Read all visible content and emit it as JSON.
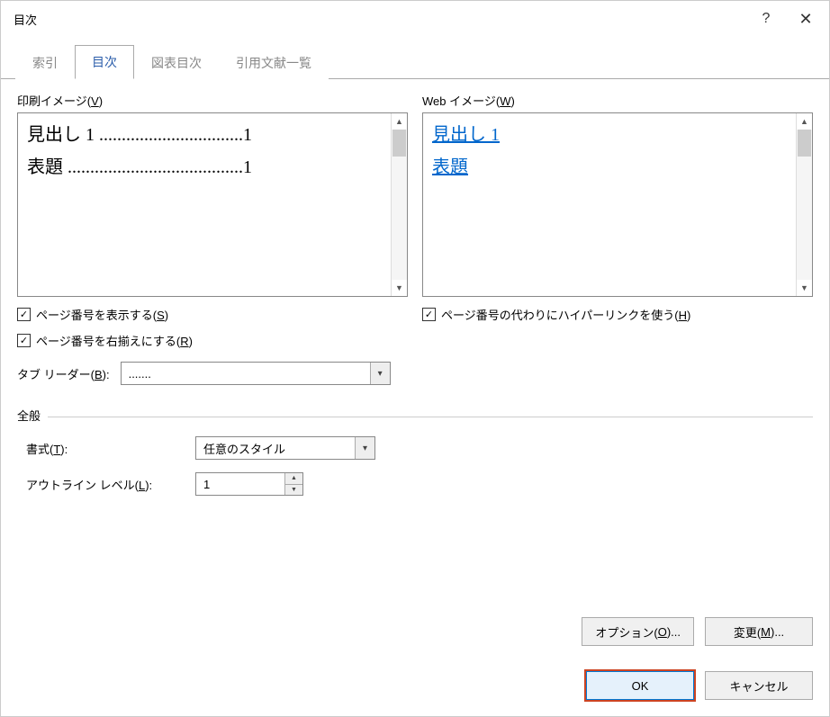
{
  "title": "目次",
  "help_icon": "?",
  "close_icon": "✕",
  "tabs": {
    "index": "索引",
    "toc": "目次",
    "figures": "図表目次",
    "citations": "引用文献一覧"
  },
  "print_preview": {
    "label_pre": "印刷イメージ(",
    "label_key": "V",
    "label_post": ")",
    "line1": "見出し 1 ................................1",
    "line2": "表題 .......................................1"
  },
  "web_preview": {
    "label_pre": "Web イメージ(",
    "label_key": "W",
    "label_post": ")",
    "link1": "見出し 1",
    "link2": "表題"
  },
  "check_show_page": {
    "pre": "ページ番号を表示する(",
    "key": "S",
    "post": ")"
  },
  "check_right_align": {
    "pre": "ページ番号を右揃えにする(",
    "key": "R",
    "post": ")"
  },
  "check_hyperlink": {
    "pre": "ページ番号の代わりにハイパーリンクを使う(",
    "key": "H",
    "post": ")"
  },
  "tab_leader": {
    "label_pre": "タブ リーダー(",
    "label_key": "B",
    "label_post": "):",
    "value": "......."
  },
  "general": {
    "heading": "全般",
    "format_label_pre": "書式(",
    "format_label_key": "T",
    "format_label_post": "):",
    "format_value": "任意のスタイル",
    "outline_label_pre": "アウトライン レベル(",
    "outline_label_key": "L",
    "outline_label_post": "):",
    "outline_value": "1"
  },
  "buttons": {
    "options_pre": "オプション(",
    "options_key": "O",
    "options_post": ")...",
    "modify_pre": "変更(",
    "modify_key": "M",
    "modify_post": ")...",
    "ok": "OK",
    "cancel": "キャンセル"
  }
}
